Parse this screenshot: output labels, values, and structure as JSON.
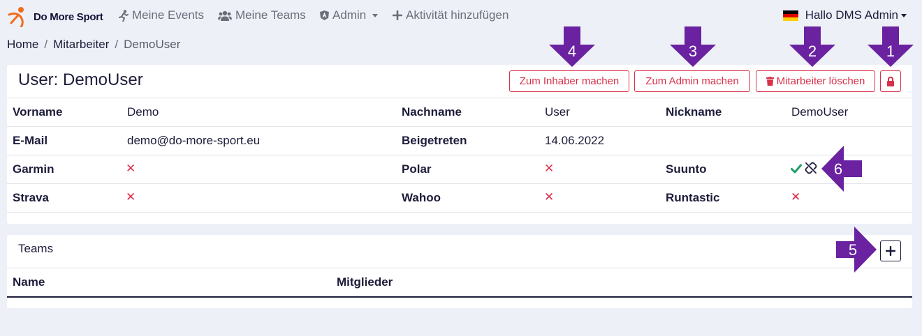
{
  "navbar": {
    "brand": "Do More Sport",
    "items": [
      {
        "label": "Meine Events",
        "icon": "running-icon"
      },
      {
        "label": "Meine Teams",
        "icon": "users-icon"
      },
      {
        "label": "Admin",
        "icon": "angular-icon"
      },
      {
        "label": "Aktivität hinzufügen",
        "icon": "plus-icon"
      }
    ],
    "user_greeting": "Hallo DMS Admin"
  },
  "breadcrumb": [
    "Home",
    "Mitarbeiter",
    "DemoUser"
  ],
  "user_card": {
    "title": "User: DemoUser",
    "actions": {
      "make_owner": "Zum Inhaber machen",
      "make_admin": "Zum Admin machen",
      "delete": "Mitarbeiter löschen"
    },
    "fields": {
      "vorname_label": "Vorname",
      "vorname": "Demo",
      "nachname_label": "Nachname",
      "nachname": "User",
      "nickname_label": "Nickname",
      "nickname": "DemoUser",
      "email_label": "E-Mail",
      "email": "demo@do-more-sport.eu",
      "joined_label": "Beigetreten",
      "joined": "14.06.2022",
      "garmin_label": "Garmin",
      "polar_label": "Polar",
      "suunto_label": "Suunto",
      "strava_label": "Strava",
      "wahoo_label": "Wahoo",
      "runtastic_label": "Runtastic"
    },
    "connections": {
      "garmin": false,
      "polar": false,
      "suunto": true,
      "strava": false,
      "wahoo": false,
      "runtastic": false
    }
  },
  "teams_card": {
    "title": "Teams",
    "columns": [
      "Name",
      "Mitglieder"
    ]
  },
  "annotations": [
    "1",
    "2",
    "3",
    "4",
    "5",
    "6"
  ],
  "colors": {
    "brand_orange": "#f26b1d",
    "danger": "#d9304a",
    "success": "#1f9d6b",
    "annotation_purple": "#6a22a0",
    "background": "#edf0f7"
  }
}
